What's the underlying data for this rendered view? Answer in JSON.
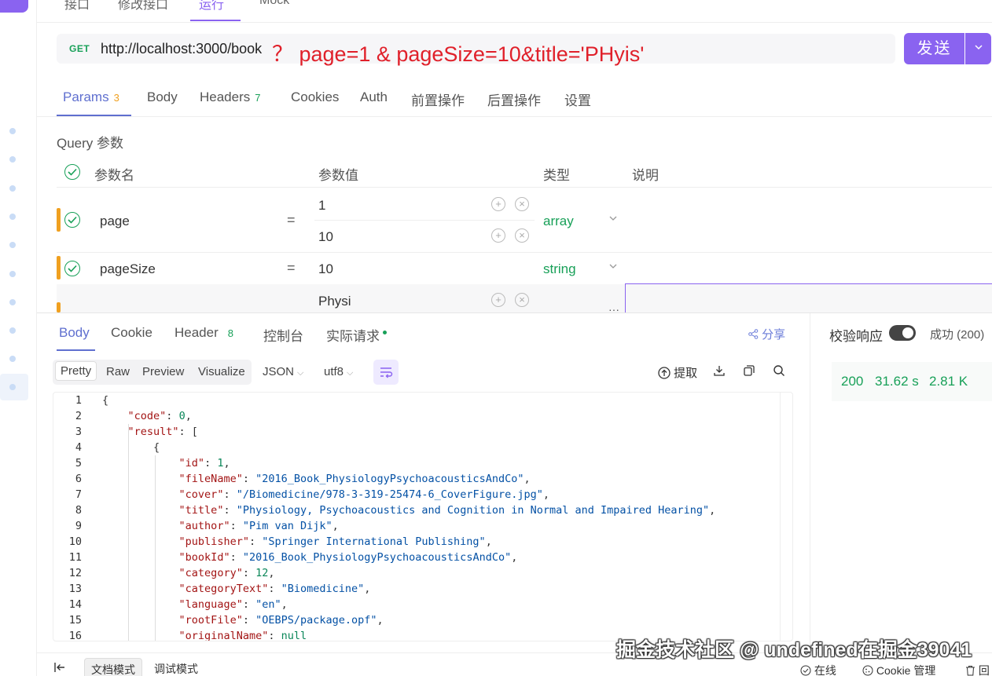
{
  "top_tabs": [
    "接口",
    "修改接口",
    "运行",
    "Mock"
  ],
  "request": {
    "method": "GET",
    "url": "http://localhost:3000/book",
    "annotation": "？ page=1 & pageSize=10&title='PHyis'",
    "send_label": "发送"
  },
  "request_tabs": [
    {
      "label": "Params",
      "count": "3"
    },
    {
      "label": "Body",
      "count": ""
    },
    {
      "label": "Headers",
      "count": "7"
    },
    {
      "label": "Cookies",
      "count": ""
    },
    {
      "label": "Auth",
      "count": ""
    },
    {
      "label": "前置操作",
      "count": ""
    },
    {
      "label": "后置操作",
      "count": ""
    },
    {
      "label": "设置",
      "count": ""
    }
  ],
  "query": {
    "section_label": "Query 参数",
    "headers": {
      "name": "参数名",
      "value": "参数值",
      "type": "类型",
      "desc": "说明"
    },
    "rows": [
      {
        "name": "page",
        "values": [
          "1",
          "10"
        ],
        "type": "array"
      },
      {
        "name": "pageSize",
        "values": [
          "10"
        ],
        "type": "string"
      },
      {
        "name": "",
        "values": [
          "Physi"
        ],
        "type": ""
      }
    ]
  },
  "response": {
    "tabs": [
      {
        "label": "Body",
        "count": ""
      },
      {
        "label": "Cookie",
        "count": ""
      },
      {
        "label": "Header",
        "count": "8"
      },
      {
        "label": "控制台",
        "count": ""
      },
      {
        "label": "实际请求",
        "count": ""
      }
    ],
    "share_label": "分享",
    "validate_label": "校验响应",
    "status_label": "成功 (200)",
    "metrics": {
      "code": "200",
      "time": "31.62 s",
      "size": "2.81 K"
    },
    "formats": [
      "Pretty",
      "Raw",
      "Preview",
      "Visualize"
    ],
    "lang": "JSON",
    "encoding": "utf8",
    "extract_label": "提取"
  },
  "code_lines": [
    "{",
    "    \"code\": 0,",
    "    \"result\": [",
    "        {",
    "            \"id\": 1,",
    "            \"fileName\": \"2016_Book_PhysiologyPsychoacousticsAndCo\",",
    "            \"cover\": \"/Biomedicine/978-3-319-25474-6_CoverFigure.jpg\",",
    "            \"title\": \"Physiology, Psychoacoustics and Cognition in Normal and Impaired Hearing\",",
    "            \"author\": \"Pim van Dijk\",",
    "            \"publisher\": \"Springer International Publishing\",",
    "            \"bookId\": \"2016_Book_PhysiologyPsychoacousticsAndCo\",",
    "            \"category\": 12,",
    "            \"categoryText\": \"Biomedicine\",",
    "            \"language\": \"en\",",
    "            \"rootFile\": \"OEBPS/package.opf\",",
    "            \"originalName\": null"
  ],
  "statusbar": {
    "doc_mode": "文档模式",
    "debug_mode": "调试模式",
    "online": "在线",
    "cookie_mgmt": "Cookie 管理",
    "recycle": "回"
  },
  "watermark": "掘金技术社区 @ undefined在掘金39041",
  "colors": {
    "accent": "#8a63f0",
    "tab_active": "#5f6fcf",
    "success": "#18a058",
    "required": "#f0a020",
    "annotation": "#e0202a"
  }
}
